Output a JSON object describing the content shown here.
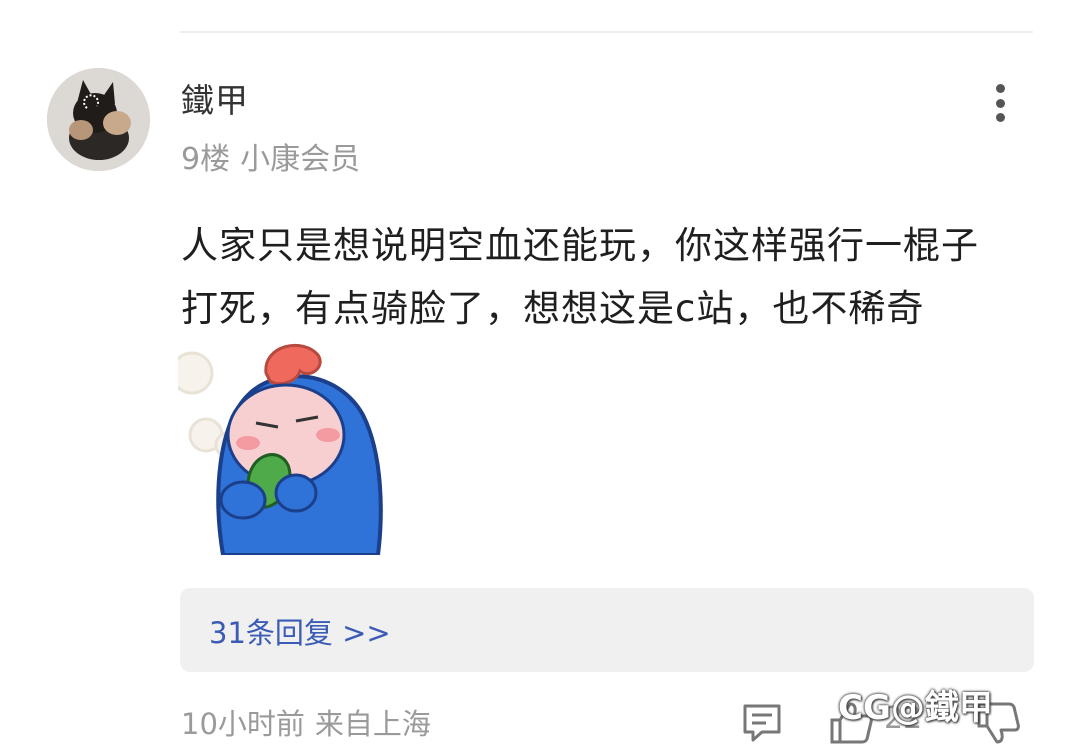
{
  "comment": {
    "author": "鐵甲",
    "floor": "9楼",
    "member_level": "小康会员",
    "text_lines": [
      "人家只是想说明空血还能玩，你这样强行一棍子",
      "打死，有点骑脸了，想想这是c站，也不稀奇"
    ],
    "sticker_icon": "sticker-blue-hooded-character-eating-leaf",
    "replies_label": "31条回复 >>",
    "time": "10小时前",
    "location": "来自上海",
    "like_count": "22"
  },
  "icons": {
    "more": "more-vertical-icon",
    "comment": "comment-icon",
    "like": "thumbs-up-icon",
    "dislike": "thumbs-down-icon"
  },
  "watermark": {
    "text": "CG@鐵甲"
  },
  "colors": {
    "link": "#3b5bb7",
    "meta": "#9a9a9a",
    "text": "#1f1f1f",
    "reply_box_bg": "#f0f0f0"
  }
}
